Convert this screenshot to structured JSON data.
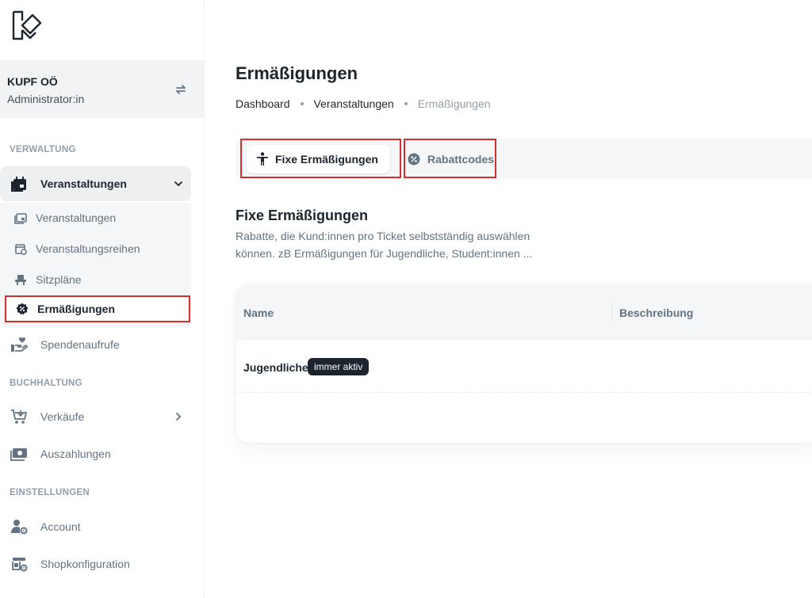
{
  "sidebar": {
    "account": {
      "name": "KUPF OÖ",
      "role": "Administrator:in"
    },
    "sections": {
      "management": "VERWALTUNG",
      "accounting": "BUCHHALTUNG",
      "settings": "EINSTELLUNGEN"
    },
    "events_parent": "Veranstaltungen",
    "submenu": [
      "Veranstaltungen",
      "Veranstaltungsreihen",
      "Sitzpläne",
      "Ermäßigungen"
    ],
    "donations": "Spendenaufrufe",
    "sales": "Verkäufe",
    "payouts": "Auszahlungen",
    "account_item": "Account",
    "shop_config": "Shopkonfiguration"
  },
  "page": {
    "title": "Ermäßigungen",
    "breadcrumb": [
      "Dashboard",
      "Veranstaltungen",
      "Ermäßigungen"
    ]
  },
  "tabs": {
    "fixed": "Fixe Ermäßigungen",
    "codes": "Rabattcodes"
  },
  "section": {
    "title": "Fixe Ermäßigungen",
    "description": "Rabatte, die Kund:innen pro Ticket selbstständig auswählen können. zB Ermäßigungen für Jugendliche, Student:innen ..."
  },
  "table": {
    "columns": [
      "Name",
      "Beschreibung"
    ],
    "rows": [
      {
        "name": "Jugendliche",
        "badge": "immer aktiv"
      }
    ]
  }
}
